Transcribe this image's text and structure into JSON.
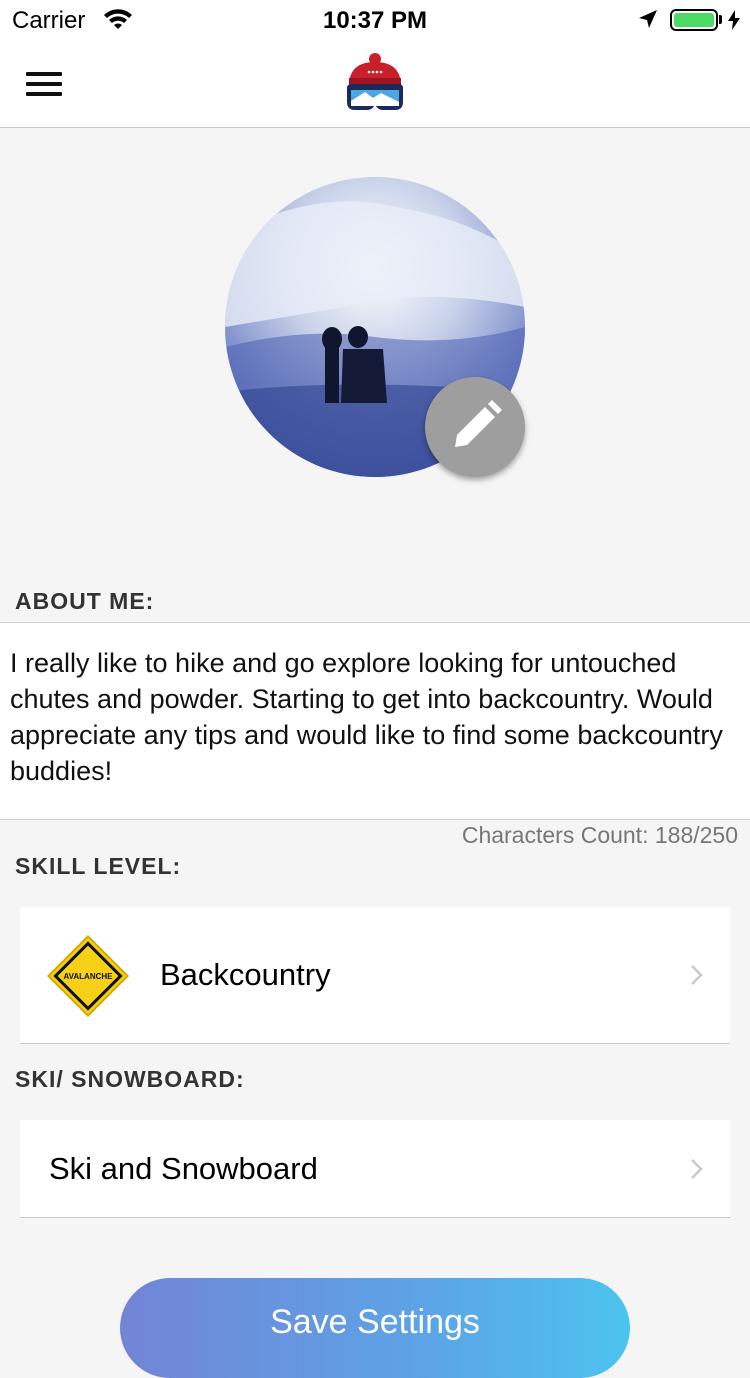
{
  "status_bar": {
    "carrier": "Carrier",
    "time": "10:37 PM",
    "battery_color": "#4cd964"
  },
  "nav": {
    "menu_icon": "hamburger-menu-icon",
    "logo_icon": "beanie-goggles-logo-icon"
  },
  "profile": {
    "photo_icon": "profile-photo",
    "edit_icon": "pencil-icon"
  },
  "about": {
    "label": "ABOUT ME:",
    "text": "I really like to hike and go explore looking for untouched chutes and powder.  Starting to get into backcountry.  Would appreciate any tips and would like to find some backcountry buddies!",
    "char_count": "Characters Count: 188/250"
  },
  "skill": {
    "label": "SKILL LEVEL:",
    "value": "Backcountry",
    "icon": "avalanche-sign-icon",
    "sign_text": "AVALANCHE"
  },
  "sport": {
    "label": "SKI/ SNOWBOARD:",
    "value": "Ski and Snowboard"
  },
  "save_button": "Save Settings",
  "colors": {
    "background": "#f5f5f5",
    "button_gradient_start": "#7384d6",
    "button_gradient_end": "#4cc4ee",
    "avalanche_yellow": "#f7d117"
  }
}
